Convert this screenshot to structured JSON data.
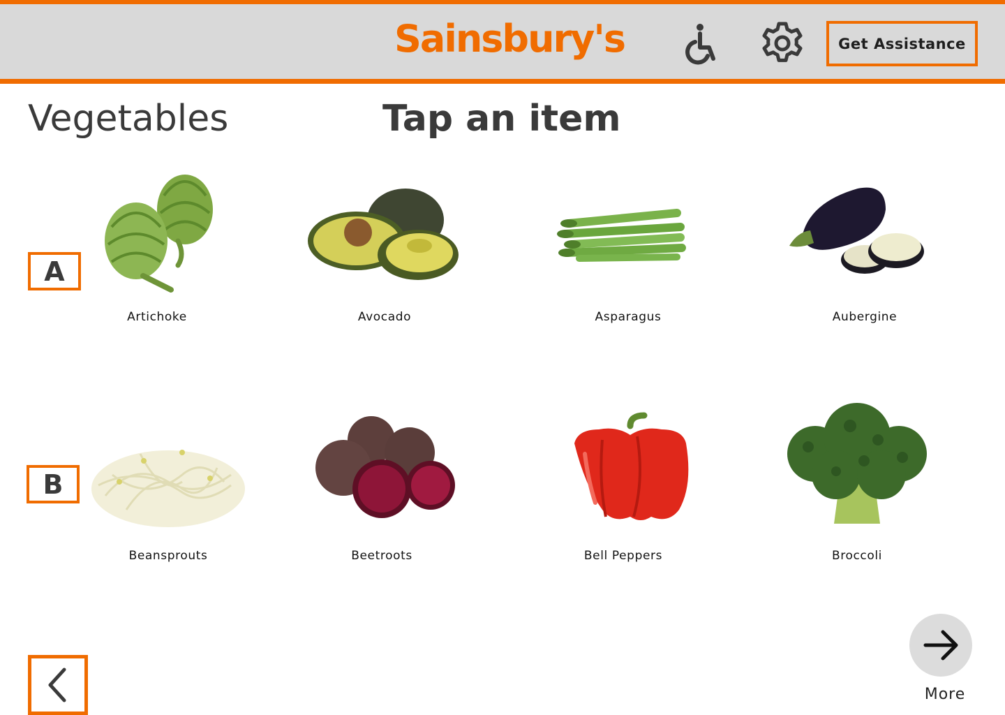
{
  "header": {
    "brand": "Sainsbury's",
    "assistance_label": "Get Assistance",
    "accessibility_icon": "wheelchair-icon",
    "settings_icon": "gear-icon",
    "accent_color": "#f06c00"
  },
  "page": {
    "category_title": "Vegetables",
    "instruction": "Tap an item"
  },
  "sections": [
    {
      "letter": "A",
      "items": [
        {
          "label": "Artichoke"
        },
        {
          "label": "Avocado"
        },
        {
          "label": "Asparagus"
        },
        {
          "label": "Aubergine"
        }
      ]
    },
    {
      "letter": "B",
      "items": [
        {
          "label": "Beansprouts"
        },
        {
          "label": "Beetroots"
        },
        {
          "label": "Bell Peppers"
        },
        {
          "label": "Broccoli"
        }
      ]
    }
  ],
  "footer": {
    "back_icon": "chevron-left-icon",
    "more_icon": "arrow-right-icon",
    "more_label": "More"
  }
}
